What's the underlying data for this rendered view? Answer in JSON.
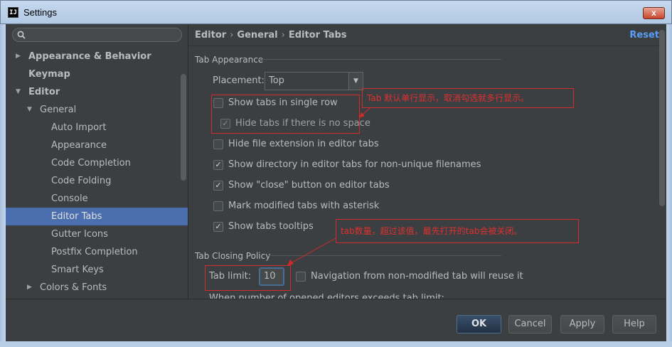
{
  "window": {
    "title": "Settings",
    "close_glyph": "x",
    "icon_text": "IJ"
  },
  "search": {
    "placeholder": ""
  },
  "tree": [
    {
      "label": "Appearance & Behavior",
      "arrow": "▶",
      "bold": true
    },
    {
      "label": "Keymap",
      "arrow": "",
      "bold": true
    },
    {
      "label": "Editor",
      "arrow": "▼",
      "bold": true
    },
    {
      "label": "General",
      "arrow": "▼",
      "bold": false
    },
    {
      "label": "Auto Import",
      "arrow": "",
      "bold": false
    },
    {
      "label": "Appearance",
      "arrow": "",
      "bold": false
    },
    {
      "label": "Code Completion",
      "arrow": "",
      "bold": false
    },
    {
      "label": "Code Folding",
      "arrow": "",
      "bold": false
    },
    {
      "label": "Console",
      "arrow": "",
      "bold": false
    },
    {
      "label": "Editor Tabs",
      "arrow": "",
      "bold": false,
      "selected": true
    },
    {
      "label": "Gutter Icons",
      "arrow": "",
      "bold": false
    },
    {
      "label": "Postfix Completion",
      "arrow": "",
      "bold": false
    },
    {
      "label": "Smart Keys",
      "arrow": "",
      "bold": false
    },
    {
      "label": "Colors & Fonts",
      "arrow": "▶",
      "bold": false
    }
  ],
  "breadcrumb": {
    "part1": "Editor",
    "part2": "General",
    "part3": "Editor Tabs",
    "sep": "›"
  },
  "reset_label": "Reset",
  "tab_appearance": {
    "title": "Tab Appearance",
    "placement_label": "Placement:",
    "placement_value": "Top",
    "placement_arrow": "▼",
    "options": [
      {
        "label": "Show tabs in single row",
        "checked": false,
        "disabled": false
      },
      {
        "label": "Hide tabs if there is no space",
        "checked": true,
        "disabled": true
      },
      {
        "label": "Hide file extension in editor tabs",
        "checked": false,
        "disabled": false
      },
      {
        "label": "Show directory in editor tabs for non-unique filenames",
        "checked": true,
        "disabled": false
      },
      {
        "label": "Show \"close\" button on editor tabs",
        "checked": true,
        "disabled": false
      },
      {
        "label": "Mark modified tabs with asterisk",
        "checked": false,
        "disabled": false
      },
      {
        "label": "Show tabs tooltips",
        "checked": true,
        "disabled": false
      }
    ]
  },
  "tab_closing": {
    "title": "Tab Closing Policy",
    "limit_label": "Tab limit:",
    "limit_value": "10",
    "nav_label": "Navigation from non-modified tab will reuse it",
    "nav_checked": false,
    "clipped_text": "When number of opened editors exceeds tab limit:"
  },
  "annotations": {
    "single_row": "Tab 默认单行显示，取消勾选就多行显示。",
    "tab_limit": "tab数量，超过该值，最先打开的tab会被关闭。"
  },
  "buttons": {
    "ok": "OK",
    "cancel": "Cancel",
    "apply": "Apply",
    "help": "Help"
  },
  "colors": {
    "background": "#3c3f41",
    "selection": "#4b6eaf",
    "link": "#589df6",
    "annotation": "#d42a2a"
  }
}
